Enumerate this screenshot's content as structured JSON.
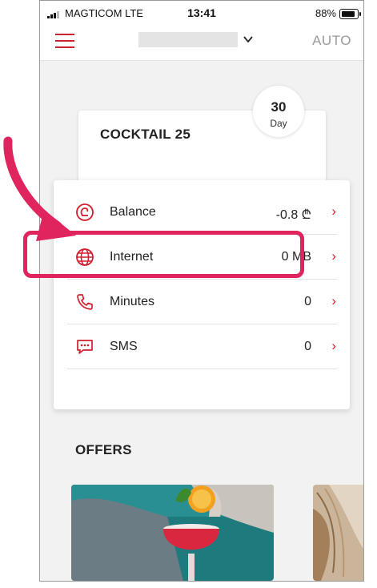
{
  "status_bar": {
    "carrier": "MAGTICOM  LTE",
    "time": "13:41",
    "battery": "88%"
  },
  "header": {
    "menu_icon": "hamburger-menu-icon",
    "dropdown_icon": "chevron-down-icon",
    "auto_label": "AUTO"
  },
  "plan": {
    "name": "COCKTAIL 25",
    "days_left": "30",
    "days_label": "Day"
  },
  "usage": [
    {
      "label": "Balance",
      "value": "-0.8 ₾",
      "icon": "balance-icon"
    },
    {
      "label": "Internet",
      "value": "0 MB",
      "icon": "globe-icon"
    },
    {
      "label": "Minutes",
      "value": "0",
      "icon": "phone-icon"
    },
    {
      "label": "SMS",
      "value": "0",
      "icon": "chat-icon"
    }
  ],
  "annotation": {
    "color": "#e0245e",
    "highlighted_row": "Internet"
  },
  "offers": {
    "title": "OFFERS"
  },
  "colors": {
    "brand_red": "#d0202f",
    "annotation_pink": "#e0245e"
  }
}
